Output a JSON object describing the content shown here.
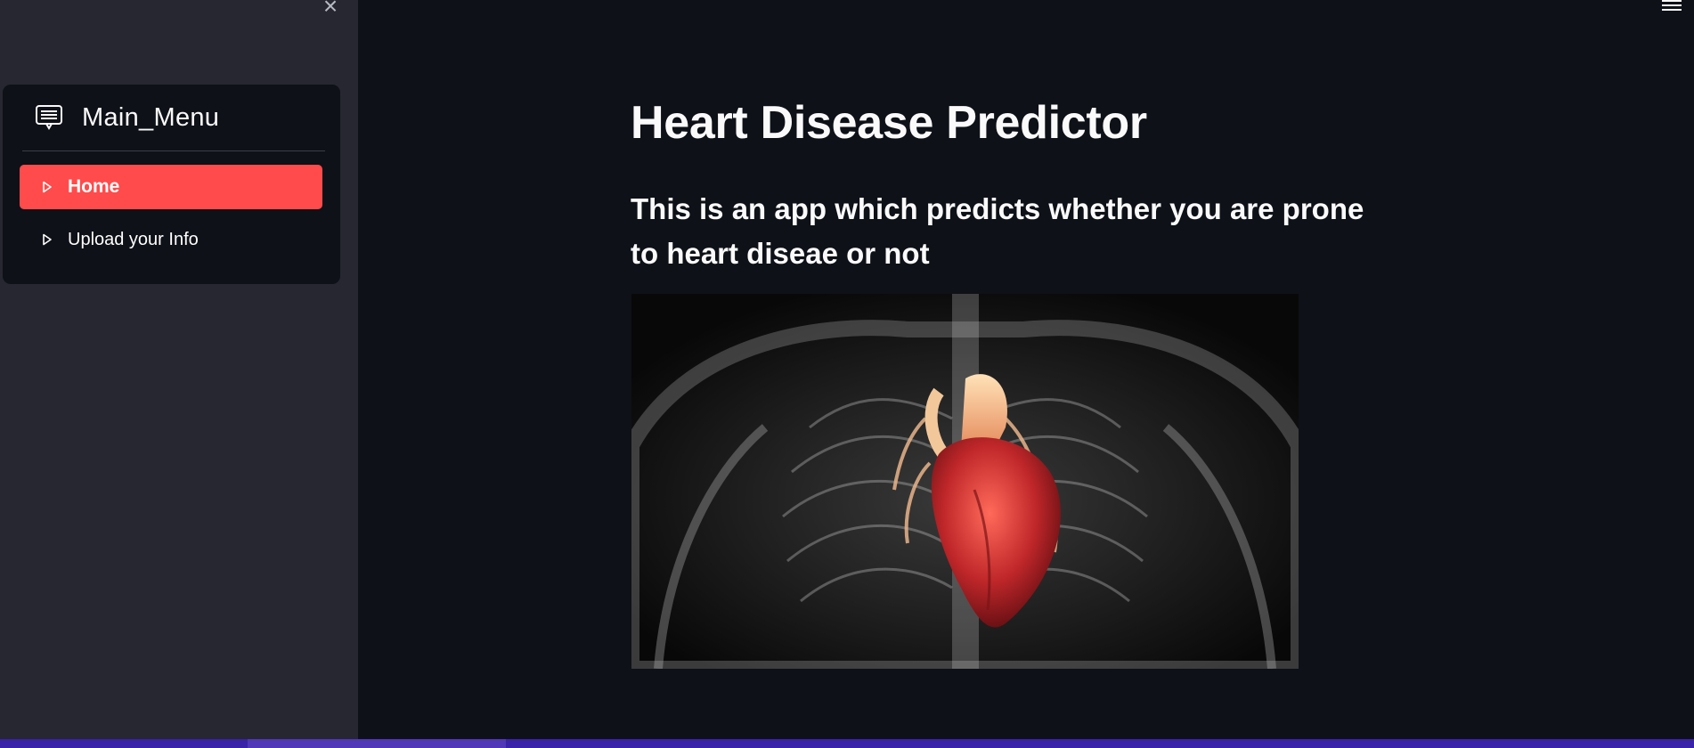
{
  "sidebar": {
    "close_icon": "close-icon",
    "menu": {
      "title": "Main_Menu",
      "header_icon": "menu-list-icon",
      "items": [
        {
          "label": "Home",
          "icon": "caret-right-icon",
          "active": true
        },
        {
          "label": "Upload your Info",
          "icon": "caret-right-icon",
          "active": false
        }
      ]
    }
  },
  "header": {
    "menu_icon": "hamburger-icon"
  },
  "main": {
    "title": "Heart Disease Predictor",
    "subtitle": "This is an app which predicts whether you are prone to heart diseae or not",
    "image": "heart-anatomy-image"
  },
  "colors": {
    "sidebar_bg": "#262730",
    "main_bg": "#0e1117",
    "accent": "#ff4b4b",
    "text": "#fafafa"
  }
}
